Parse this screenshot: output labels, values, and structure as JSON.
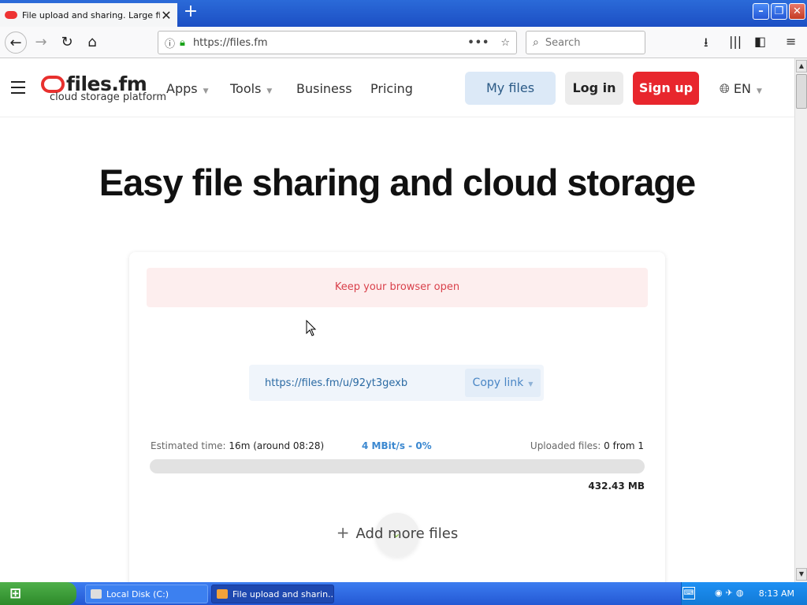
{
  "browser": {
    "tab_title": "File upload and sharing. Large file",
    "url": "https://files.fm",
    "search_placeholder": "Search"
  },
  "site": {
    "logo_name": "files.fm",
    "logo_tagline": "cloud storage platform",
    "menu": [
      {
        "label": "Apps",
        "has_caret": true
      },
      {
        "label": "Tools",
        "has_caret": true
      },
      {
        "label": "Business",
        "has_caret": false
      },
      {
        "label": "Pricing",
        "has_caret": false
      }
    ],
    "my_files": "My files",
    "log_in": "Log in",
    "sign_up": "Sign up",
    "language": "EN"
  },
  "hero": {
    "title": "Easy file sharing and cloud storage"
  },
  "upload": {
    "alert": "Keep your browser open",
    "share_link": "https://files.fm/u/92yt3gexb",
    "copy_link": "Copy link",
    "estimated_label": "Estimated time:",
    "estimated_value": "16m (around 08:28)",
    "speed": "4 MBit/s - 0%",
    "uploaded_label": "Uploaded files:",
    "uploaded_value": "0 from 1",
    "progress": 0,
    "size": "432.43 MB",
    "add_more": "Add more files"
  },
  "taskbar": {
    "start_label": "",
    "tasks": [
      {
        "label": "Local Disk (C:)"
      },
      {
        "label": "File upload and sharin..."
      }
    ],
    "time": "8:13 AM"
  },
  "colors": {
    "brand_red": "#e8262d",
    "link_blue": "#3b88d0"
  }
}
